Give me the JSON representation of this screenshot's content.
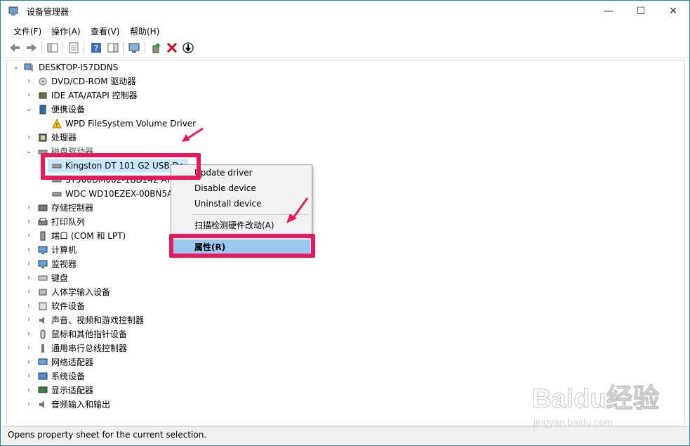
{
  "window": {
    "title": "设备管理器",
    "min_glyph": "—",
    "max_glyph": "☐",
    "close_glyph": "✕"
  },
  "menu": [
    "文件(F)",
    "操作(A)",
    "查看(V)",
    "帮助(H)"
  ],
  "tree": {
    "root": "DESKTOP-I57DDNS",
    "items": [
      "DVD/CD-ROM 驱动器",
      "IDE ATA/ATAPI 控制器",
      "便携设备",
      "WPD FileSystem Volume Driver",
      "处理器",
      "磁盘驱动器",
      "Kingston DT 101 G2 USB De",
      "ST500DM002-1BD142 ATA",
      "WDC WD10EZEX-00BN5A0",
      "存储控制器",
      "打印队列",
      "端口 (COM 和 LPT)",
      "计算机",
      "监视器",
      "键盘",
      "人体学输入设备",
      "软件设备",
      "声音、视频和游戏控制器",
      "鼠标和其他指针设备",
      "通用串行总线控制器",
      "网络适配器",
      "系统设备",
      "显示适配器",
      "音频输入和输出"
    ]
  },
  "context_menu": {
    "update": "Update driver",
    "disable": "Disable device",
    "uninstall": "Uninstall device",
    "scan": "扫描检测硬件改动(A)",
    "properties": "属性(R)"
  },
  "status": "Opens property sheet for the current selection.",
  "watermark": {
    "brand": "Baidu经验",
    "url": "jingyan.baidu.com"
  },
  "colors": {
    "highlight": "#e8195d",
    "selection": "#cce8ff",
    "menu_hover": "#99c9ef",
    "frame": "#1a8fb5"
  }
}
